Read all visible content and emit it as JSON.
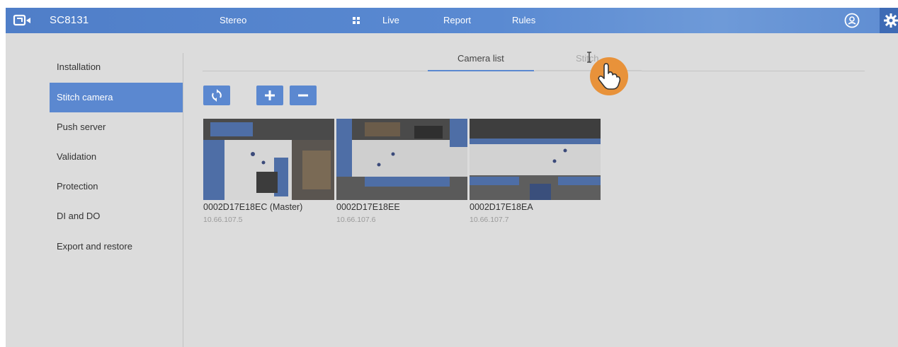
{
  "header": {
    "model": "SC8131",
    "nav": [
      {
        "label": "Stereo"
      },
      {
        "label": "Live"
      },
      {
        "label": "Report"
      },
      {
        "label": "Rules"
      }
    ],
    "icons": {
      "logo": "camera-logo-icon",
      "grid": "grid-icon",
      "user": "user-icon",
      "settings": "gear-icon"
    }
  },
  "sidebar": {
    "items": [
      {
        "label": "Installation",
        "active": false
      },
      {
        "label": "Stitch camera",
        "active": true
      },
      {
        "label": "Push server",
        "active": false
      },
      {
        "label": "Validation",
        "active": false
      },
      {
        "label": "Protection",
        "active": false
      },
      {
        "label": "DI and DO",
        "active": false
      },
      {
        "label": "Export and restore",
        "active": false
      }
    ]
  },
  "tabs": [
    {
      "label": "Camera list",
      "active": true
    },
    {
      "label": "Stitch",
      "active": false
    }
  ],
  "toolbar": {
    "refresh_icon": "refresh-icon",
    "add_icon": "plus-icon",
    "remove_icon": "minus-icon"
  },
  "cameras": [
    {
      "name": "0002D17E18EC (Master)",
      "ip": "10.66.107.5"
    },
    {
      "name": "0002D17E18EE",
      "ip": "10.66.107.6"
    },
    {
      "name": "0002D17E18EA",
      "ip": "10.66.107.7"
    }
  ],
  "colors": {
    "accent": "#5b88d0",
    "topbar": "#4f7ec8",
    "background": "#dcdcdc",
    "cursor_badge": "#e8923a"
  }
}
